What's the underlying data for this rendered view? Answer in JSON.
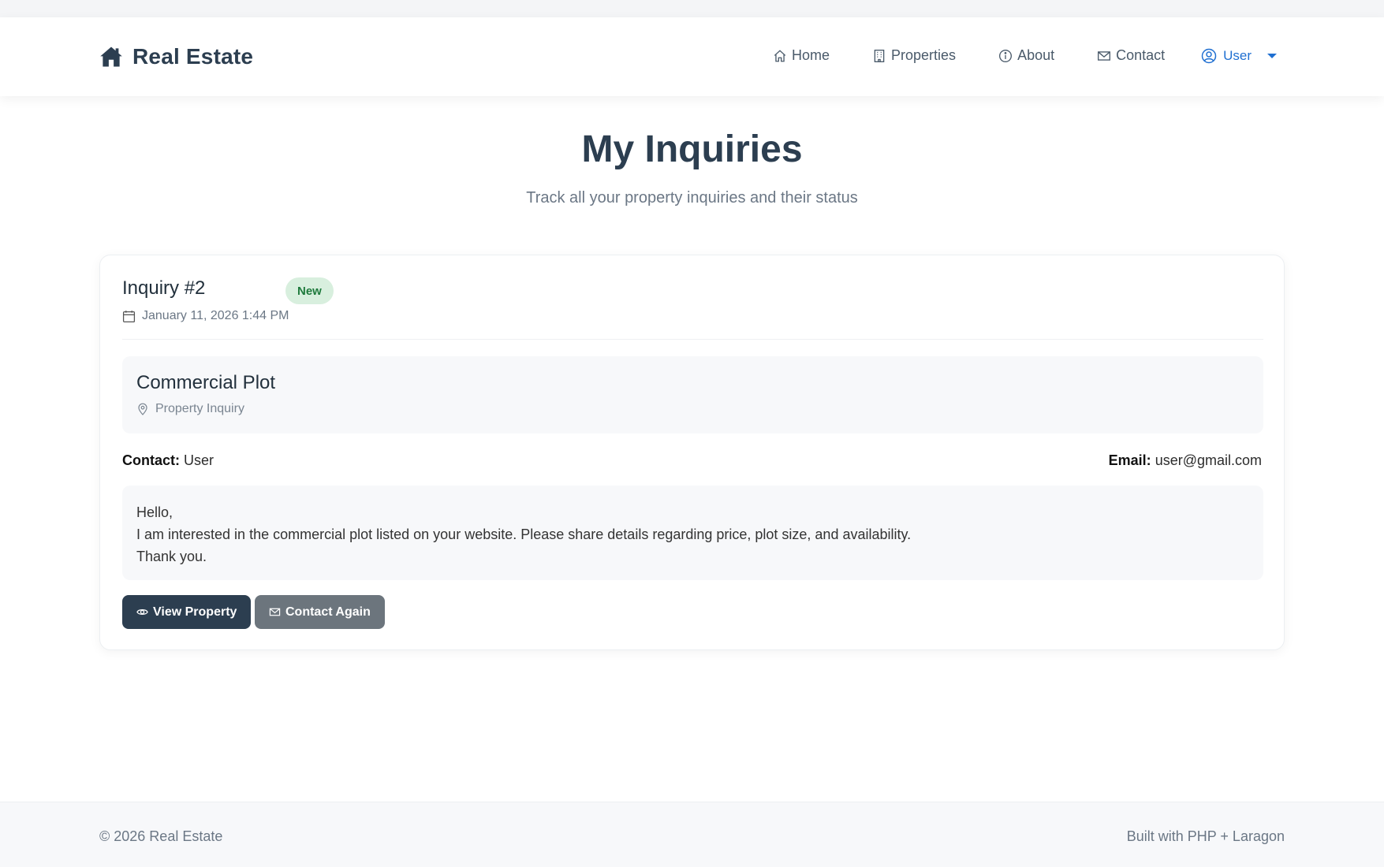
{
  "brand": {
    "name": "Real Estate",
    "icon": "house-icon"
  },
  "nav": {
    "items": [
      {
        "label": "Home",
        "icon": "home-icon"
      },
      {
        "label": "Properties",
        "icon": "building-icon"
      },
      {
        "label": "About",
        "icon": "info-icon"
      },
      {
        "label": "Contact",
        "icon": "envelope-icon"
      }
    ],
    "user": {
      "label": "User",
      "icon": "user-circle-icon"
    }
  },
  "page": {
    "title": "My Inquiries",
    "subtitle": "Track all your property inquiries and their status"
  },
  "inquiry": {
    "title": "Inquiry #2",
    "status": "New",
    "date": "January 11, 2026 1:44 PM",
    "property_name": "Commercial Plot",
    "property_type": "Property Inquiry",
    "contact_label": "Contact:",
    "contact_value": "User",
    "email_label": "Email:",
    "email_value": "user@gmail.com",
    "message_lines": [
      "Hello,",
      "I am interested in the commercial plot listed on your website. Please share details regarding price, plot size, and availability.",
      "Thank you."
    ],
    "view_button": "View Property",
    "contact_button": "Contact Again"
  },
  "footer": {
    "left": "© 2026 Real Estate",
    "right": "Built with PHP + Laragon"
  },
  "colors": {
    "primary": "#2c3e50",
    "secondary": "#6c757d",
    "accent": "#1f6fd1",
    "badge_bg": "#d8efde",
    "badge_text": "#1e7a3c"
  }
}
